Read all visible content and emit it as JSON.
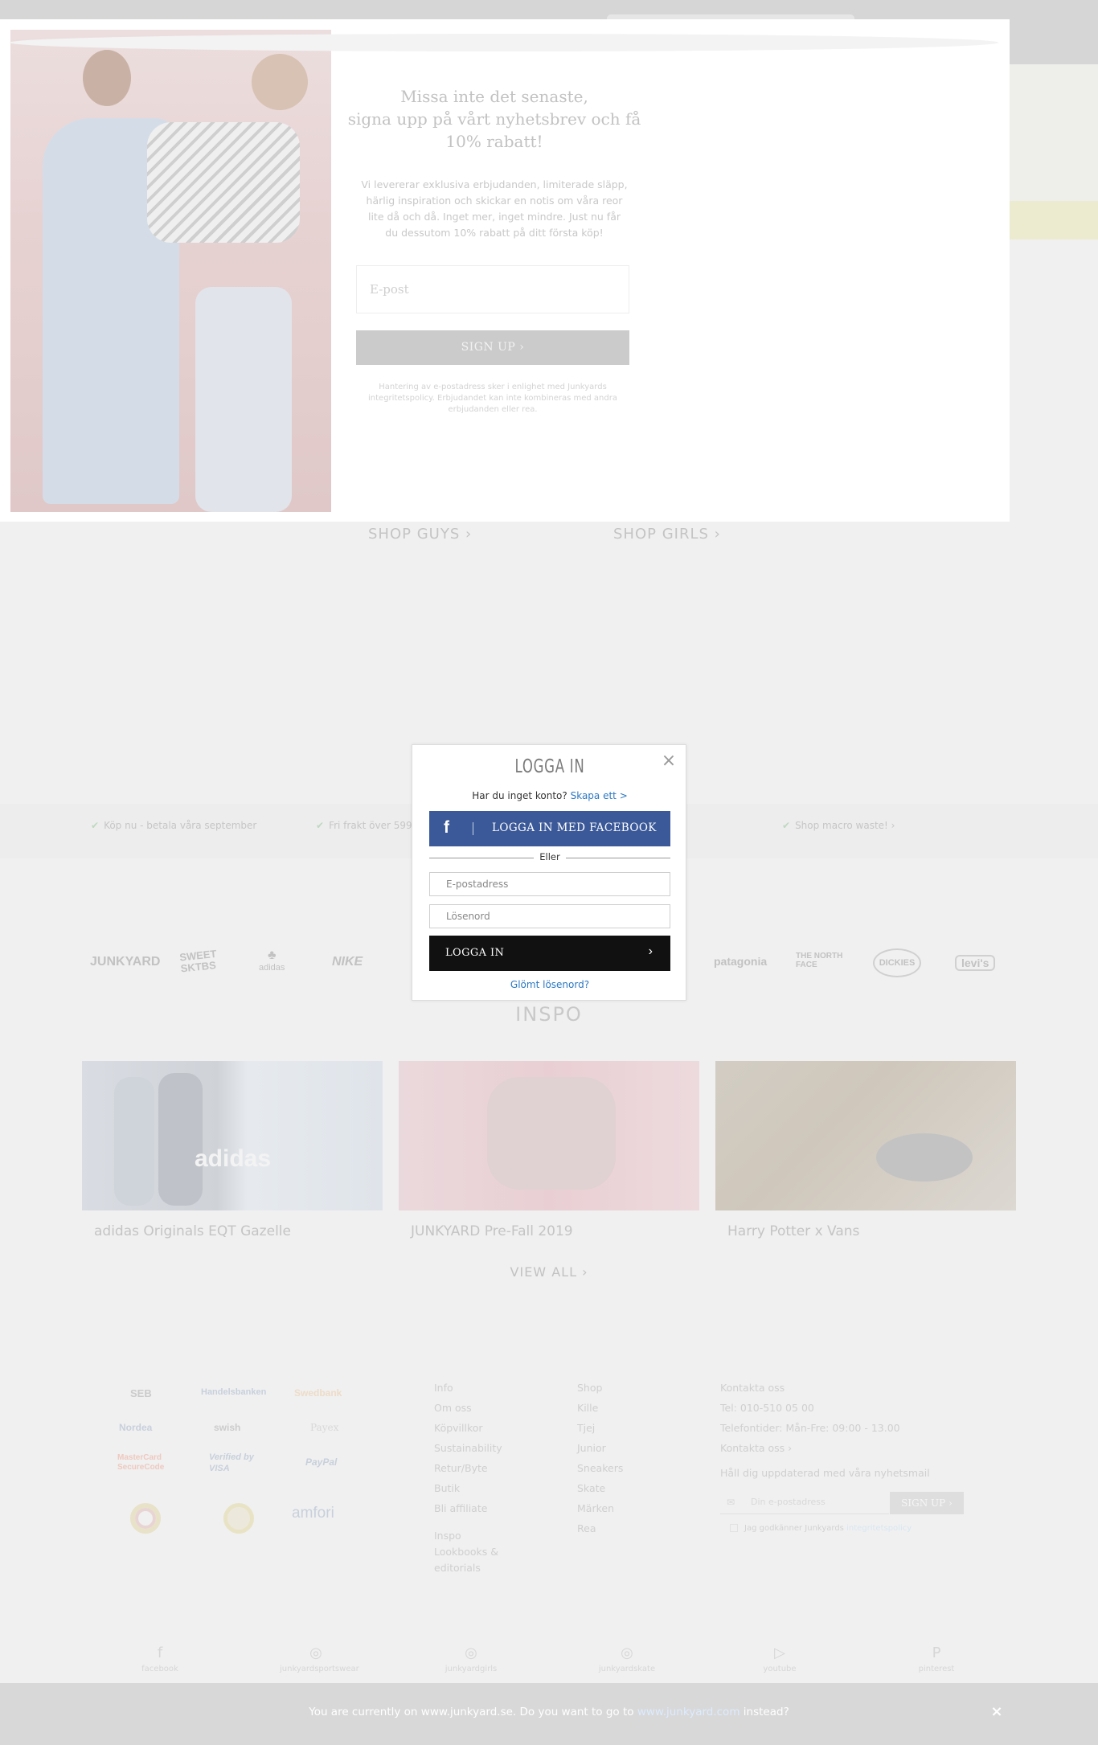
{
  "newsletter": {
    "headline_1": "Missa inte det senaste,",
    "headline_2": "signa upp på vårt nyhetsbrev och få",
    "headline_3": "10% rabatt!",
    "body_1": "Vi levererar exklusiva erbjudanden, limiterade släpp,",
    "body_2": "härlig inspiration och skickar en notis om våra reor",
    "body_3": "lite då och då. Inget mer, inget mindre. Just nu får",
    "body_4": "du dessutom 10% rabatt på ditt första köp!",
    "email_placeholder": "E-post",
    "signup_label": "SIGN UP ›",
    "fine_1": "Hantering av e-postadress sker i enlighet med Junkyards",
    "fine_2": "integritetspolicy. Erbjudandet kan inte kombineras med andra",
    "fine_3": "erbjudanden eller rea."
  },
  "shop": {
    "guys": "SHOP GUYS ›",
    "girls": "SHOP GIRLS ›"
  },
  "usps": [
    "Köp nu - betala våra september",
    "Fri frakt över 599",
    "Shop macro waste! ›"
  ],
  "brands": [
    "JUNKYARD",
    "SWEET SKTBS",
    "adidas",
    "NIKE",
    "patagonia",
    "THE NORTH FACE",
    "DICKIES",
    "levi's"
  ],
  "login": {
    "title": "LOGGA IN",
    "no_account": "Har du inget konto?",
    "create_link": "Skapa ett >",
    "facebook_label": "LOGGA IN MED FACEBOOK",
    "or": "Eller",
    "email_placeholder": "E-postadress",
    "password_placeholder": "Lösenord",
    "submit_label": "LOGGA IN",
    "forgot": "Glömt lösenord?"
  },
  "inspo": {
    "title": "INSPO",
    "cards": [
      {
        "caption": "adidas Originals EQT Gazelle",
        "art_text": "adidas"
      },
      {
        "caption": "JUNKYARD Pre-Fall 2019"
      },
      {
        "caption": "Harry Potter x Vans"
      }
    ],
    "view_all": "VIEW ALL ›"
  },
  "payments": [
    "SEB",
    "Handelsbanken",
    "Swedbank",
    "Nordea",
    "swish",
    "Payex",
    "MasterCard SecureCode",
    "Verified by VISA",
    "PayPal",
    "amfori"
  ],
  "footer": {
    "info": {
      "heading": "Info",
      "items": [
        "Om oss",
        "Köpvillkor",
        "Sustainability",
        "Retur/Byte",
        "Butik",
        "Bli affiliate"
      ],
      "inspo_heading": "Inspo",
      "inspo_items": [
        "Lookbooks &",
        "editorials"
      ]
    },
    "shop": {
      "heading": "Shop",
      "items": [
        "Kille",
        "Tjej",
        "Junior",
        "Sneakers",
        "Skate",
        "Märken",
        "Rea"
      ]
    },
    "contact": {
      "heading": "Kontakta oss",
      "phone": "Tel: 010-510 05 00",
      "hours": "Telefontider: Mån-Fre: 09:00 - 13.00",
      "link": "Kontakta oss ›",
      "newsletter": "Håll dig uppdaterad med våra nyhetsmail",
      "email_placeholder": "Din e-postadress",
      "signup_label": "SIGN UP ›",
      "consent": "Jag godkänner Junkyards",
      "consent_link": "integritetspolicy"
    },
    "social": [
      {
        "label": "facebook",
        "icon": "f"
      },
      {
        "label": "junkyardsportswear",
        "icon": "◎"
      },
      {
        "label": "junkyardgirls",
        "icon": "◎"
      },
      {
        "label": "junkyardskate",
        "icon": "◎"
      },
      {
        "label": "youtube",
        "icon": "▷"
      },
      {
        "label": "pinterest",
        "icon": "P"
      }
    ]
  },
  "redirect": {
    "text_before": "You are currently on www.junkyard.se. Do you want to go to",
    "link": "www.junkyard.com",
    "text_after": "instead?",
    "close": "×"
  },
  "colors": {
    "facebook_blue": "#3b5998",
    "link_blue": "#2a78c2",
    "login_button": "#111111"
  }
}
